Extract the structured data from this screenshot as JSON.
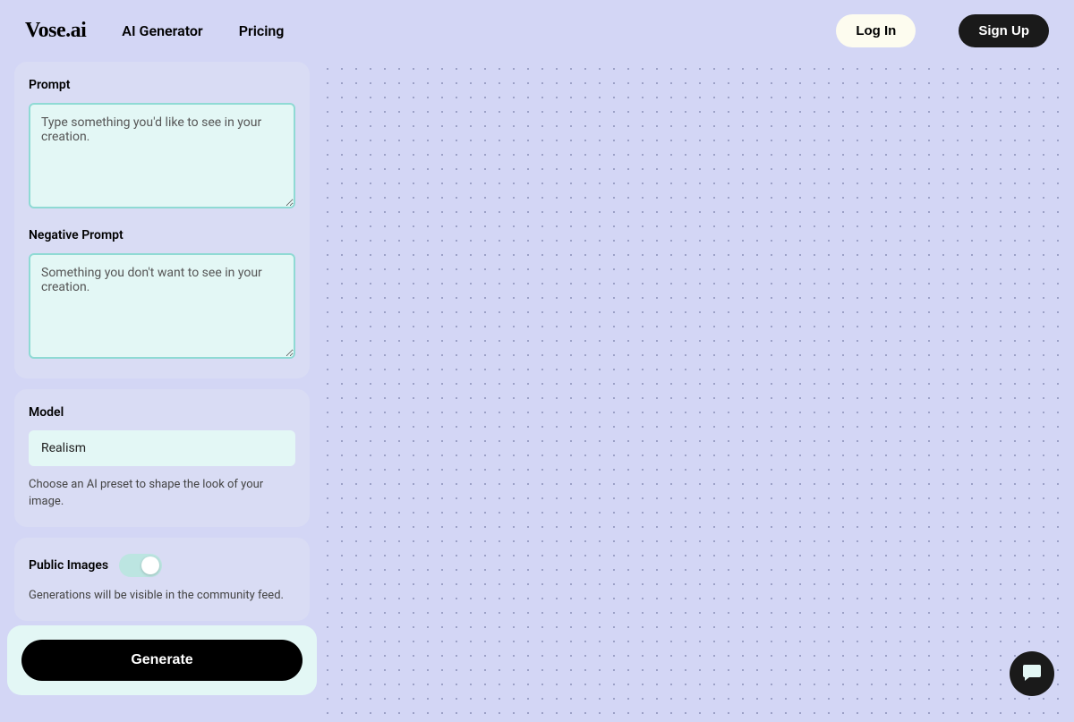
{
  "brand": "Vose.ai",
  "nav": {
    "ai_generator": "AI Generator",
    "pricing": "Pricing"
  },
  "auth": {
    "login": "Log In",
    "signup": "Sign Up"
  },
  "prompt": {
    "label": "Prompt",
    "placeholder": "Type something you'd like to see in your creation.",
    "value": ""
  },
  "negative_prompt": {
    "label": "Negative Prompt",
    "placeholder": "Something you don't want to see in your creation.",
    "value": ""
  },
  "model": {
    "label": "Model",
    "selected": "Realism",
    "helper": "Choose an AI preset to shape the look of your image."
  },
  "public_images": {
    "label": "Public Images",
    "on": true,
    "helper": "Generations will be visible in the community feed."
  },
  "generate_label": "Generate"
}
